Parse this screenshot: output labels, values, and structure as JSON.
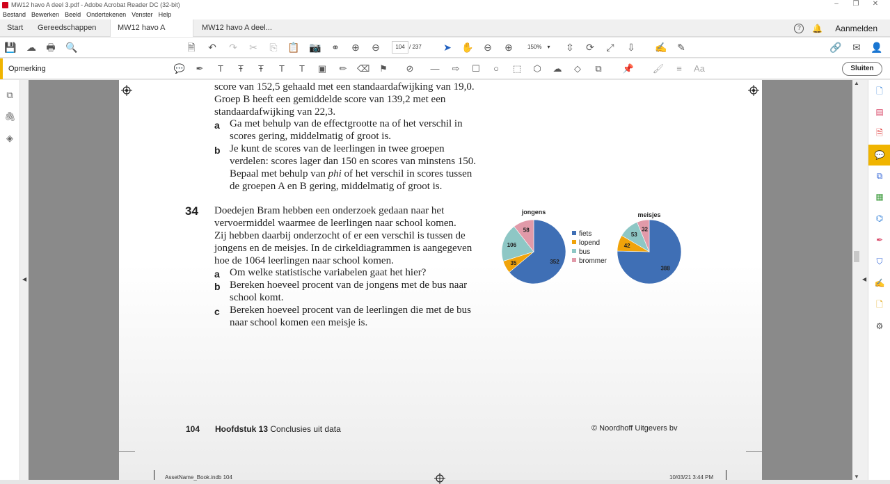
{
  "window": {
    "title": "MW12 havo A deel 3.pdf - Adobe Acrobat Reader DC (32-bit)",
    "controls": [
      "–",
      "❐",
      "✕"
    ]
  },
  "menu": [
    "Bestand",
    "Bewerken",
    "Beeld",
    "Ondertekenen",
    "Venster",
    "Help"
  ],
  "tabs": {
    "start": "Start",
    "tools": "Gereedschappen",
    "doc1": "MW12 havo A deel...",
    "doc2": "MW12 havo A deel...",
    "close": "×",
    "signin": "Aanmelden"
  },
  "toolbar": {
    "page_current": "104",
    "page_total": "/ 237",
    "zoom": "150%"
  },
  "commentbar": {
    "label": "Opmerking",
    "close": "Sluiten",
    "font_tool": "Aa"
  },
  "content": {
    "top_lines": [
      "score van 152,5 gehaald met een standaardafwijking van 19,0.",
      "Groep B heeft een gemiddelde score van 139,2 met een",
      "standaardafwijking van 22,3."
    ],
    "q33a_label": "a",
    "q33a": [
      "Ga met behulp van de effectgrootte na of het verschil in",
      "scores gering, middelmatig of groot is."
    ],
    "q33b_label": "b",
    "q33b": [
      "Je kunt de scores van de leerlingen in twee groepen",
      "verdelen: scores lager dan 150 en scores van minstens 150.",
      "Bepaal met behulp van ",
      "phi",
      " of het verschil in scores tussen",
      "de groepen A en B gering, middelmatig of groot is."
    ],
    "q34_number": "34",
    "q34_text": [
      "Doedejen Bram hebben een onderzoek gedaan naar het",
      "vervoermiddel waarmee de leerlingen naar school komen.",
      "Zij hebben daarbij onderzocht of er een verschil is tussen de",
      "jongens en de meisjes. In de cirkeldiagrammen is aangegeven",
      "hoe de 1064 leerlingen naar school komen."
    ],
    "q34a_label": "a",
    "q34a": "Om welke statistische variabelen gaat het hier?",
    "q34b_label": "b",
    "q34b": [
      "Bereken hoeveel procent van de jongens met de bus naar",
      "school komt."
    ],
    "q34c_label": "c",
    "q34c": [
      "Bereken hoeveel procent van de leerlingen die met de bus",
      "naar school komen een meisje is."
    ],
    "footer_page": "104",
    "footer_chapter_bold": "Hoofdstuk 13",
    "footer_chapter": "Conclusies uit data",
    "footer_publisher": "© Noordhoff Uitgevers bv",
    "slug_left": "AssetName_Book.indb   104",
    "slug_right": "10/03/21   3:44 PM"
  },
  "chart_data": [
    {
      "type": "pie",
      "title": "jongens",
      "categories": [
        "fiets",
        "lopend",
        "bus",
        "brommer"
      ],
      "values": [
        352,
        35,
        106,
        58
      ],
      "colors": [
        "#3f6fb5",
        "#f0a30a",
        "#8ec7c5",
        "#e19aa9"
      ]
    },
    {
      "type": "pie",
      "title": "meisjes",
      "categories": [
        "fiets",
        "lopend",
        "bus",
        "brommer"
      ],
      "values": [
        388,
        42,
        53,
        32
      ],
      "colors": [
        "#3f6fb5",
        "#f0a30a",
        "#8ec7c5",
        "#e19aa9"
      ],
      "legend": "left"
    }
  ]
}
